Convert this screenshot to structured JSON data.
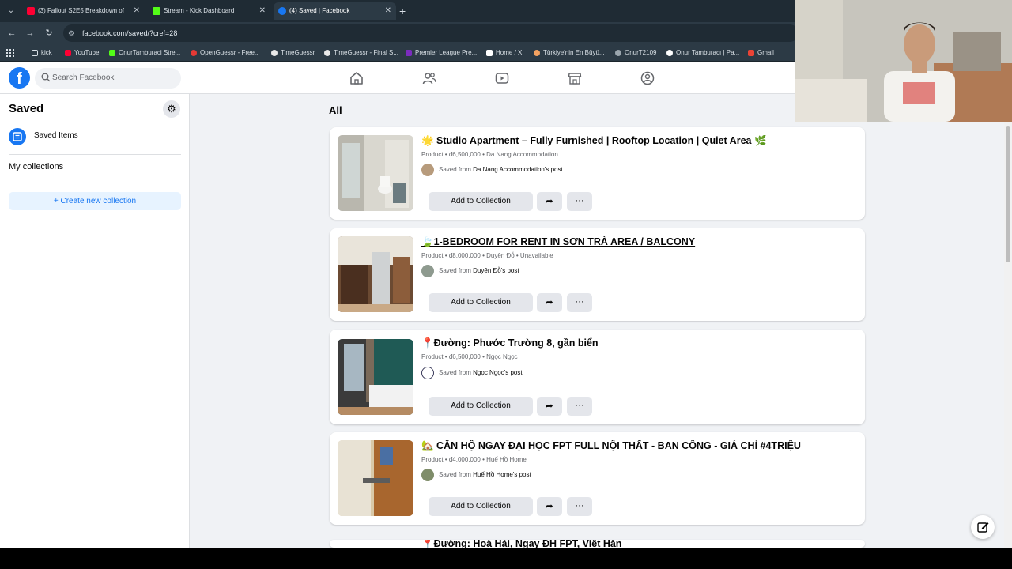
{
  "browser": {
    "tabs": [
      {
        "title": "(3) Fallout S2E5 Breakdown of",
        "active": false,
        "favicon_color": "#ff0033"
      },
      {
        "title": "Stream - Kick Dashboard",
        "active": false,
        "favicon_color": "#53fc18"
      },
      {
        "title": "(4) Saved | Facebook",
        "active": true,
        "favicon_color": "#1877f2"
      }
    ],
    "url": "facebook.com/saved/?cref=28",
    "bookmarks": [
      {
        "label": "kick",
        "color": "#9aa5ad"
      },
      {
        "label": "YouTube",
        "color": "#ff0033"
      },
      {
        "label": "OnurTamburaci Stre...",
        "color": "#53fc18"
      },
      {
        "label": "OpenGuessr - Free...",
        "color": "#e53935"
      },
      {
        "label": "TimeGuessr",
        "color": "#e9e9e9"
      },
      {
        "label": "TimeGuessr - Final S...",
        "color": "#e9e9e9"
      },
      {
        "label": "Premier League Pre...",
        "color": "#7b2cbf"
      },
      {
        "label": "Home / X",
        "color": "#ffffff"
      },
      {
        "label": "Türkiye'nin En Büyü...",
        "color": "#f4a261"
      },
      {
        "label": "OnurT2109",
        "color": "#9aa5ad"
      },
      {
        "label": "Onur Tamburacı | Pa...",
        "color": "#ffffff"
      },
      {
        "label": "Gmail",
        "color": "#ea4335"
      }
    ]
  },
  "facebook": {
    "search_placeholder": "Search Facebook",
    "sidebar": {
      "title": "Saved",
      "item_label": "Saved Items",
      "collections_title": "My collections",
      "create_label": "+ Create new collection"
    },
    "main_title": "All",
    "cards": [
      {
        "title": "🌟 Studio Apartment – Fully Furnished | Rooftop Location | Quiet Area 🌿",
        "meta": "Product • đ6,500,000 • Da Nang Accommodation",
        "saved_prefix": "Saved from",
        "saved_source": "Da Nang Accommodation's post",
        "add_label": "Add to Collection",
        "share_icon": "share-icon",
        "more_icon": "more-icon"
      },
      {
        "title": "🍃1-BEDROOM FOR RENT IN SƠN TRÀ AREA / BALCONY",
        "meta": "Product • đ8,000,000 • Duyên Đỗ • Unavailable",
        "saved_prefix": "Saved from",
        "saved_source": "Duyên Đỗ's post",
        "add_label": "Add to Collection",
        "share_icon": "share-icon",
        "more_icon": "more-icon"
      },
      {
        "title": "📍Đường: Phước Trường 8, gần biển",
        "meta": "Product • đ6,500,000 • Ngọc Ngọc",
        "saved_prefix": "Saved from",
        "saved_source": "Ngọc Ngọc's post",
        "add_label": "Add to Collection",
        "share_icon": "share-icon",
        "more_icon": "more-icon"
      },
      {
        "title": "🏡 CĂN HỘ NGAY ĐẠI HỌC FPT FULL NỘI THẤT - BAN CÔNG - GIÁ CHỈ #4TRIỆU",
        "meta": "Product • đ4,000,000 • Huế Hồ Home",
        "saved_prefix": "Saved from",
        "saved_source": "Huế Hồ Home's post",
        "add_label": "Add to Collection",
        "share_icon": "share-icon",
        "more_icon": "more-icon"
      }
    ],
    "partial_card_title": "📍Đường: Hoà Hải, Ngay ĐH FPT, Việt Hàn"
  }
}
